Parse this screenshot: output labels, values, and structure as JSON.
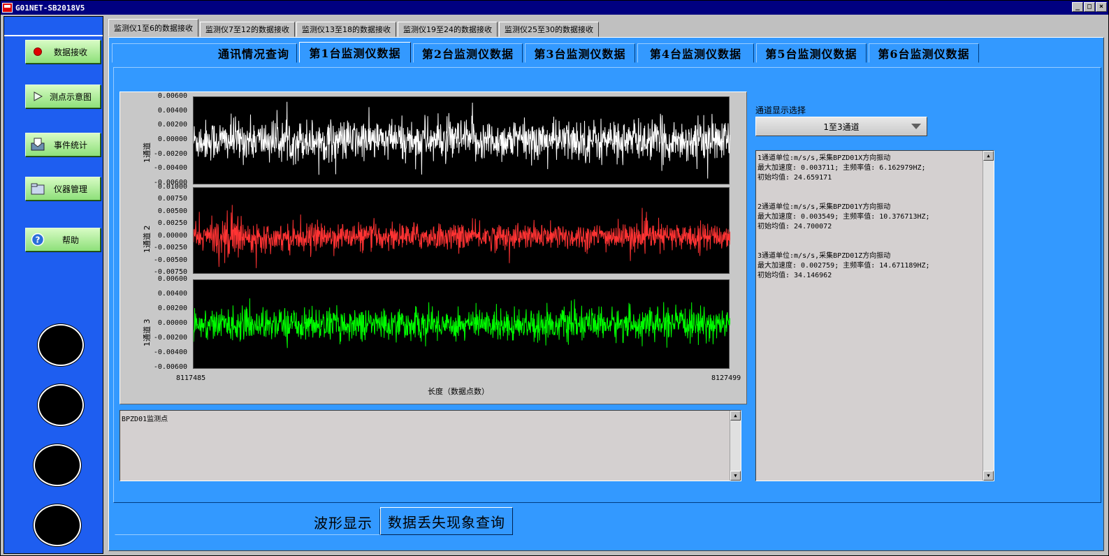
{
  "window": {
    "title": "G01NET-SB2018V5",
    "buttons": [
      "_",
      "□",
      "×"
    ]
  },
  "sidebar": {
    "buttons": [
      {
        "label": "数据接收",
        "icon": "red-dot-icon"
      },
      {
        "label": "测点示意图",
        "icon": "play-icon"
      },
      {
        "label": "事件统计",
        "icon": "inbox-icon"
      },
      {
        "label": "仪器管理",
        "icon": "folder-icon"
      },
      {
        "label": "帮助",
        "icon": "help-icon"
      }
    ]
  },
  "top_tabs": [
    "监测仪1至6的数据接收",
    "监测仪7至12的数据接收",
    "监测仪13至18的数据接收",
    "监测仪19至24的数据接收",
    "监测仪25至30的数据接收"
  ],
  "sub_tabs": [
    "通讯情况查询",
    "第1台监测仪数据",
    "第2台监测仪数据",
    "第3台监测仪数据",
    "第4台监测仪数据",
    "第5台监测仪数据",
    "第6台监测仪数据"
  ],
  "bottom_tabs": [
    "波形显示",
    "数据丢失现象查询"
  ],
  "channel_select": {
    "label": "通道显示选择",
    "value": "1至3通道"
  },
  "point_box": {
    "text": "BPZD01监测点"
  },
  "info_box": {
    "lines": [
      "1通道单位:m/s/s,采集BPZD01X方向振动",
      "最大加速度: 0.003711;  主频率值: 6.162979HZ;",
      "初始均值: 24.659171",
      "",
      "",
      "2通道单位:m/s/s,采集BPZD01Y方向振动",
      "最大加速度: 0.003549;  主频率值: 10.376713HZ;",
      "初始均值: 24.700072",
      "",
      "",
      "3通道单位:m/s/s,采集BPZD01Z方向振动",
      "最大加速度: 0.002759;  主频率值: 14.671189HZ;",
      "初始均值: 34.146962"
    ]
  },
  "chart_data": {
    "type": "line",
    "xlabel": "长度（数据点数）",
    "xlim": [
      8117485,
      8127499
    ],
    "x_ticks": [
      "8117485",
      "8127499"
    ],
    "panels": [
      {
        "name": "1通道",
        "color": "#ffffff",
        "ylim": [
          -0.006,
          0.006
        ],
        "y_ticks": [
          "0.00600",
          "0.00400",
          "0.00200",
          "0.00000",
          "-0.00200",
          "-0.00400",
          "-0.00600"
        ],
        "amplitude": 0.0037
      },
      {
        "name": "1通道 2",
        "color": "#ff3333",
        "ylim": [
          -0.0075,
          0.01
        ],
        "y_ticks": [
          "0.01000",
          "0.00750",
          "0.00500",
          "0.00250",
          "0.00000",
          "-0.00250",
          "-0.00500",
          "-0.00750"
        ],
        "amplitude": 0.0035
      },
      {
        "name": "1通道 3",
        "color": "#00ff00",
        "ylim": [
          -0.006,
          0.006
        ],
        "y_ticks": [
          "0.00600",
          "0.00400",
          "0.00200",
          "0.00000",
          "-0.00200",
          "-0.00400",
          "-0.00600"
        ],
        "amplitude": 0.0028
      }
    ]
  }
}
